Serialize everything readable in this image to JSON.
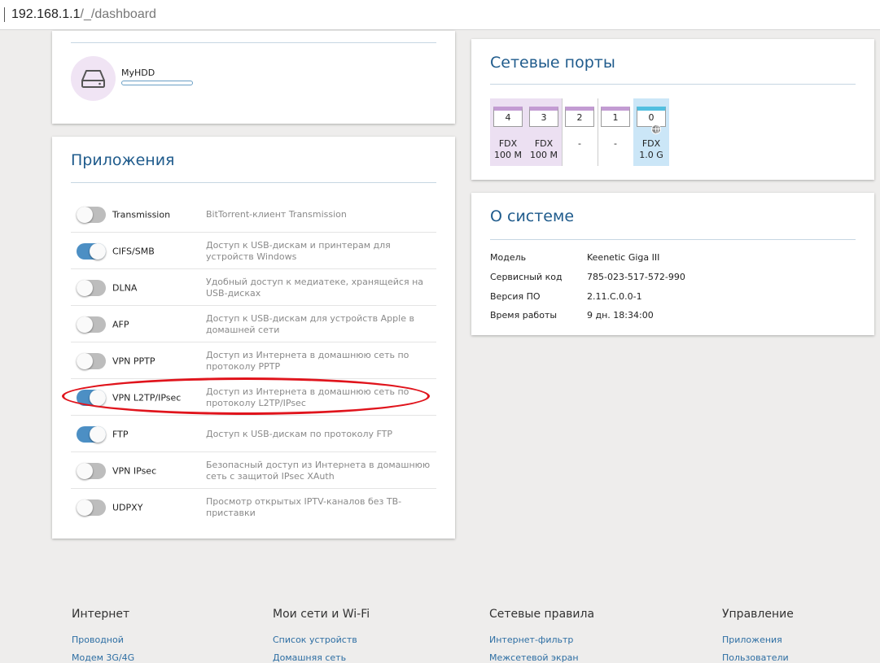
{
  "browser": {
    "url_host": "192.168.1.1",
    "url_path": "/_/dashboard"
  },
  "storage": {
    "device_name": "MyHDD"
  },
  "apps": {
    "title": "Приложения",
    "items": [
      {
        "name": "Transmission",
        "desc": "BitTorrent-клиент Transmission",
        "on": false
      },
      {
        "name": "CIFS/SMB",
        "desc": "Доступ к USB-дискам и принтерам для устройств Windows",
        "on": true
      },
      {
        "name": "DLNA",
        "desc": "Удобный доступ к медиатеке, хранящейся на USB-дисках",
        "on": false
      },
      {
        "name": "AFP",
        "desc": "Доступ к USB-дискам для устройств Apple в домашней сети",
        "on": false
      },
      {
        "name": "VPN PPTP",
        "desc": "Доступ из Интернета в домашнюю сеть по протоколу PPTP",
        "on": false
      },
      {
        "name": "VPN L2TP/IPsec",
        "desc": "Доступ из Интернета в домашнюю сеть по протоколу L2TP/IPsec",
        "on": true
      },
      {
        "name": "FTP",
        "desc": "Доступ к USB-дискам по протоколу FTP",
        "on": true
      },
      {
        "name": "VPN IPsec",
        "desc": "Безопасный доступ из Интернета в домашнюю сеть с защитой IPsec XAuth",
        "on": false
      },
      {
        "name": "UDPXY",
        "desc": "Просмотр открытых IPTV-каналов без ТВ-приставки",
        "on": false
      }
    ]
  },
  "ports": {
    "title": "Сетевые порты",
    "items": [
      {
        "num": "4",
        "line1": "FDX",
        "line2": "100 M",
        "state": "active"
      },
      {
        "num": "3",
        "line1": "FDX",
        "line2": "100 M",
        "state": "active"
      },
      {
        "num": "2",
        "line1": "-",
        "line2": "",
        "state": "idle"
      },
      {
        "num": "1",
        "line1": "-",
        "line2": "",
        "state": "idle"
      },
      {
        "num": "0",
        "line1": "FDX",
        "line2": "1.0 G",
        "state": "wan"
      }
    ]
  },
  "system": {
    "title": "О системе",
    "rows": [
      {
        "label": "Модель",
        "value": "Keenetic Giga III"
      },
      {
        "label": "Сервисный код",
        "value": "785-023-517-572-990"
      },
      {
        "label": "Версия ПО",
        "value": "2.11.C.0.0-1"
      },
      {
        "label": "Время работы",
        "value": "9 дн. 18:34:00"
      }
    ]
  },
  "footer": {
    "columns": [
      {
        "heading": "Интернет",
        "links": [
          "Проводной",
          "Модем 3G/4G"
        ]
      },
      {
        "heading": "Мои сети и Wi-Fi",
        "links": [
          "Список устройств",
          "Домашняя сеть"
        ]
      },
      {
        "heading": "Сетевые правила",
        "links": [
          "Интернет-фильтр",
          "Межсетевой экран"
        ]
      },
      {
        "heading": "Управление",
        "links": [
          "Приложения",
          "Пользователи"
        ]
      }
    ]
  },
  "colors": {
    "accent": "#1f5b8c",
    "toggle_on": "#4c8fc4",
    "annotation": "#e0141c",
    "port_active": "#ece0f2",
    "port_wan": "#cbe6f7"
  }
}
